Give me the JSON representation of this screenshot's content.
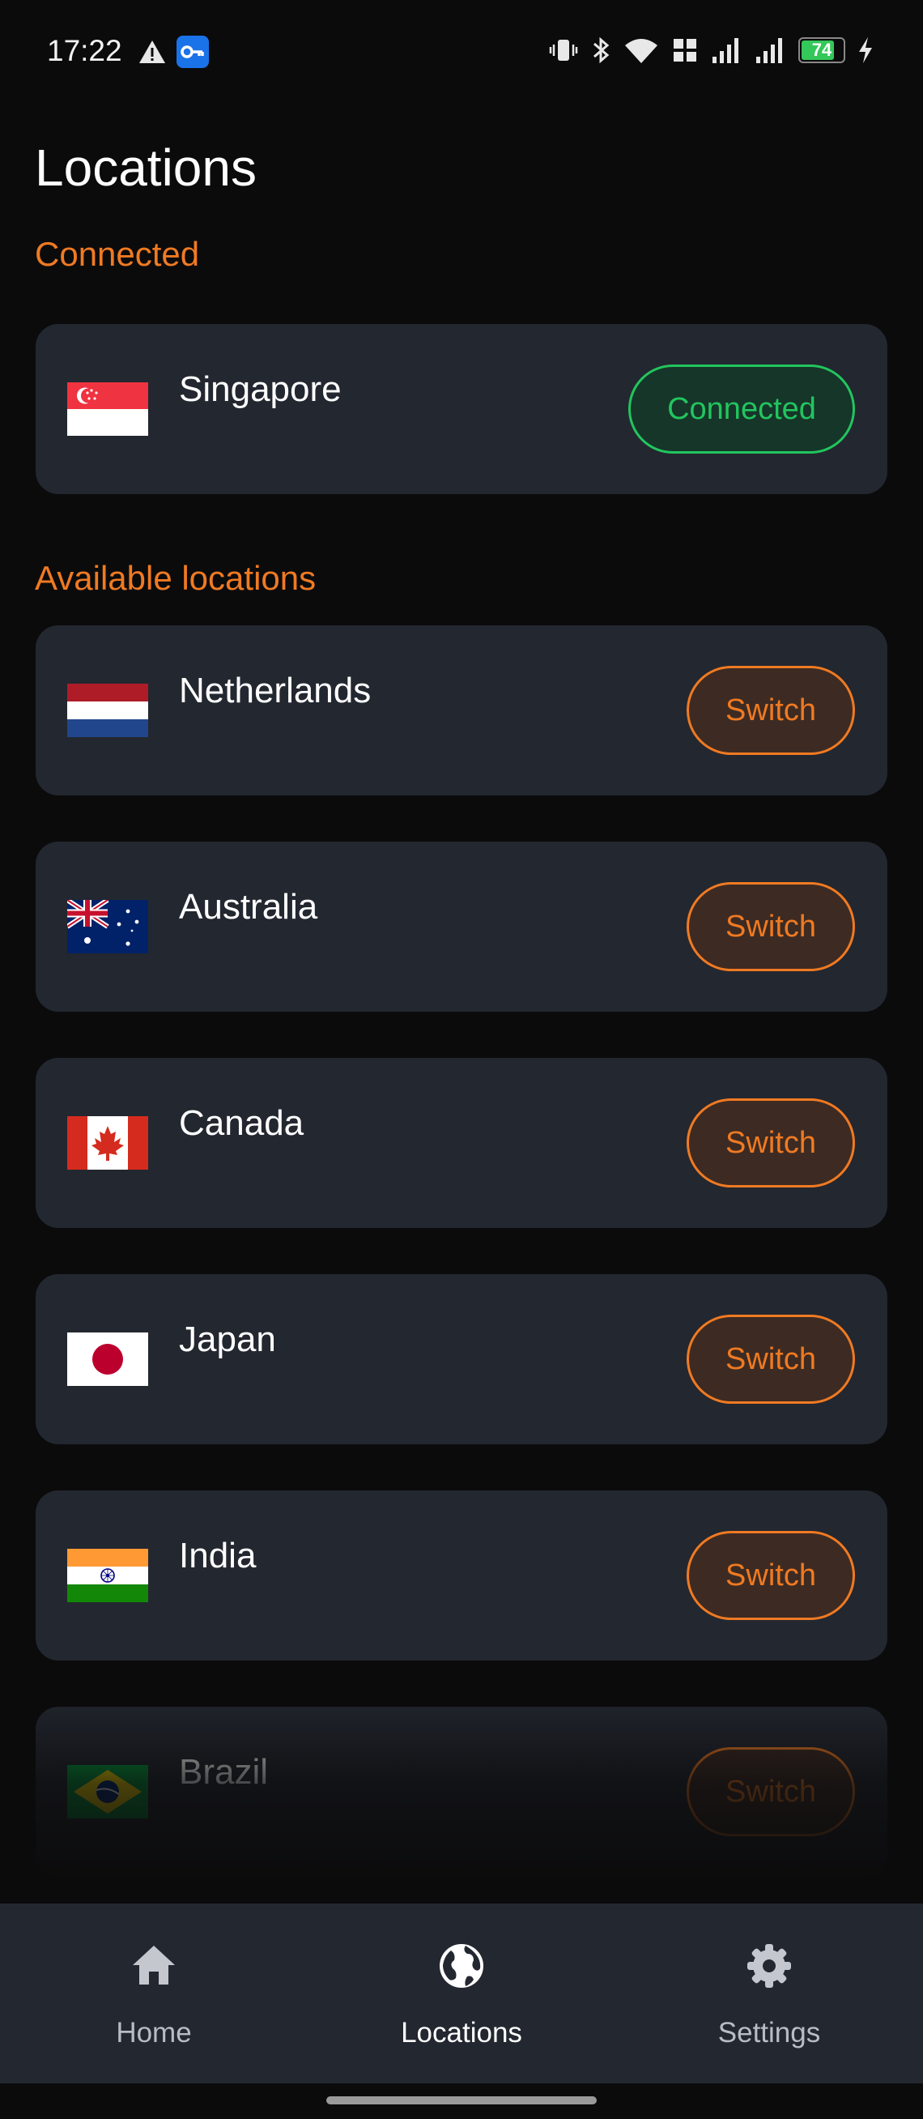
{
  "status_bar": {
    "time": "17:22",
    "battery": "74",
    "icons": [
      "warning-icon",
      "vpn-key-icon",
      "vibrate-icon",
      "bluetooth-icon",
      "wifi-icon",
      "volte-icon",
      "signal-icon",
      "signal-icon",
      "battery-icon",
      "charging-icon"
    ]
  },
  "page": {
    "title": "Locations",
    "connected_section": "Connected",
    "available_section": "Available locations"
  },
  "connected": {
    "name": "Singapore",
    "flag": "singapore-flag",
    "button_label": "Connected",
    "status_color": "#22c55e"
  },
  "available": [
    {
      "name": "Netherlands",
      "flag": "netherlands-flag",
      "button_label": "Switch"
    },
    {
      "name": "Australia",
      "flag": "australia-flag",
      "button_label": "Switch"
    },
    {
      "name": "Canada",
      "flag": "canada-flag",
      "button_label": "Switch"
    },
    {
      "name": "Japan",
      "flag": "japan-flag",
      "button_label": "Switch"
    },
    {
      "name": "India",
      "flag": "india-flag",
      "button_label": "Switch"
    },
    {
      "name": "Brazil",
      "flag": "brazil-flag",
      "button_label": "Switch"
    }
  ],
  "nav": {
    "items": [
      {
        "label": "Home",
        "icon": "home-icon",
        "active": false
      },
      {
        "label": "Locations",
        "icon": "globe-icon",
        "active": true
      },
      {
        "label": "Settings",
        "icon": "gear-icon",
        "active": false
      }
    ]
  },
  "colors": {
    "accent": "#f07a22",
    "connected": "#22c55e",
    "card_bg": "#232730",
    "background": "#0b0b0c"
  }
}
